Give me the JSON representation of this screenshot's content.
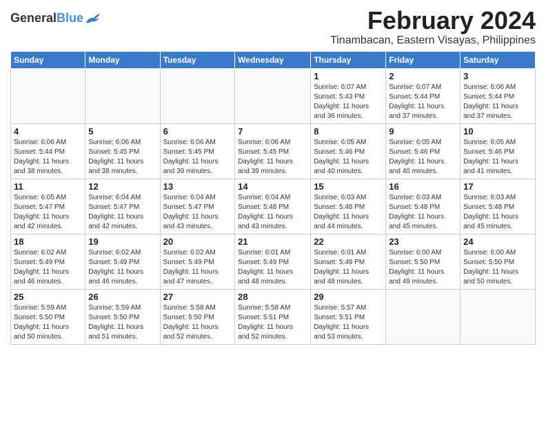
{
  "logo": {
    "text_general": "General",
    "text_blue": "Blue"
  },
  "title": {
    "month_year": "February 2024",
    "location": "Tinambacan, Eastern Visayas, Philippines"
  },
  "weekdays": [
    "Sunday",
    "Monday",
    "Tuesday",
    "Wednesday",
    "Thursday",
    "Friday",
    "Saturday"
  ],
  "weeks": [
    [
      {
        "day": "",
        "info": ""
      },
      {
        "day": "",
        "info": ""
      },
      {
        "day": "",
        "info": ""
      },
      {
        "day": "",
        "info": ""
      },
      {
        "day": "1",
        "info": "Sunrise: 6:07 AM\nSunset: 5:43 PM\nDaylight: 11 hours\nand 36 minutes."
      },
      {
        "day": "2",
        "info": "Sunrise: 6:07 AM\nSunset: 5:44 PM\nDaylight: 11 hours\nand 37 minutes."
      },
      {
        "day": "3",
        "info": "Sunrise: 6:06 AM\nSunset: 5:44 PM\nDaylight: 11 hours\nand 37 minutes."
      }
    ],
    [
      {
        "day": "4",
        "info": "Sunrise: 6:06 AM\nSunset: 5:44 PM\nDaylight: 11 hours\nand 38 minutes."
      },
      {
        "day": "5",
        "info": "Sunrise: 6:06 AM\nSunset: 5:45 PM\nDaylight: 11 hours\nand 38 minutes."
      },
      {
        "day": "6",
        "info": "Sunrise: 6:06 AM\nSunset: 5:45 PM\nDaylight: 11 hours\nand 39 minutes."
      },
      {
        "day": "7",
        "info": "Sunrise: 6:06 AM\nSunset: 5:45 PM\nDaylight: 11 hours\nand 39 minutes."
      },
      {
        "day": "8",
        "info": "Sunrise: 6:05 AM\nSunset: 5:46 PM\nDaylight: 11 hours\nand 40 minutes."
      },
      {
        "day": "9",
        "info": "Sunrise: 6:05 AM\nSunset: 5:46 PM\nDaylight: 11 hours\nand 40 minutes."
      },
      {
        "day": "10",
        "info": "Sunrise: 6:05 AM\nSunset: 5:46 PM\nDaylight: 11 hours\nand 41 minutes."
      }
    ],
    [
      {
        "day": "11",
        "info": "Sunrise: 6:05 AM\nSunset: 5:47 PM\nDaylight: 11 hours\nand 42 minutes."
      },
      {
        "day": "12",
        "info": "Sunrise: 6:04 AM\nSunset: 5:47 PM\nDaylight: 11 hours\nand 42 minutes."
      },
      {
        "day": "13",
        "info": "Sunrise: 6:04 AM\nSunset: 5:47 PM\nDaylight: 11 hours\nand 43 minutes."
      },
      {
        "day": "14",
        "info": "Sunrise: 6:04 AM\nSunset: 5:48 PM\nDaylight: 11 hours\nand 43 minutes."
      },
      {
        "day": "15",
        "info": "Sunrise: 6:03 AM\nSunset: 5:48 PM\nDaylight: 11 hours\nand 44 minutes."
      },
      {
        "day": "16",
        "info": "Sunrise: 6:03 AM\nSunset: 5:48 PM\nDaylight: 11 hours\nand 45 minutes."
      },
      {
        "day": "17",
        "info": "Sunrise: 6:03 AM\nSunset: 5:48 PM\nDaylight: 11 hours\nand 45 minutes."
      }
    ],
    [
      {
        "day": "18",
        "info": "Sunrise: 6:02 AM\nSunset: 5:49 PM\nDaylight: 11 hours\nand 46 minutes."
      },
      {
        "day": "19",
        "info": "Sunrise: 6:02 AM\nSunset: 5:49 PM\nDaylight: 11 hours\nand 46 minutes."
      },
      {
        "day": "20",
        "info": "Sunrise: 6:02 AM\nSunset: 5:49 PM\nDaylight: 11 hours\nand 47 minutes."
      },
      {
        "day": "21",
        "info": "Sunrise: 6:01 AM\nSunset: 5:49 PM\nDaylight: 11 hours\nand 48 minutes."
      },
      {
        "day": "22",
        "info": "Sunrise: 6:01 AM\nSunset: 5:49 PM\nDaylight: 11 hours\nand 48 minutes."
      },
      {
        "day": "23",
        "info": "Sunrise: 6:00 AM\nSunset: 5:50 PM\nDaylight: 11 hours\nand 49 minutes."
      },
      {
        "day": "24",
        "info": "Sunrise: 6:00 AM\nSunset: 5:50 PM\nDaylight: 11 hours\nand 50 minutes."
      }
    ],
    [
      {
        "day": "25",
        "info": "Sunrise: 5:59 AM\nSunset: 5:50 PM\nDaylight: 11 hours\nand 50 minutes."
      },
      {
        "day": "26",
        "info": "Sunrise: 5:59 AM\nSunset: 5:50 PM\nDaylight: 11 hours\nand 51 minutes."
      },
      {
        "day": "27",
        "info": "Sunrise: 5:58 AM\nSunset: 5:50 PM\nDaylight: 11 hours\nand 52 minutes."
      },
      {
        "day": "28",
        "info": "Sunrise: 5:58 AM\nSunset: 5:51 PM\nDaylight: 11 hours\nand 52 minutes."
      },
      {
        "day": "29",
        "info": "Sunrise: 5:57 AM\nSunset: 5:51 PM\nDaylight: 11 hours\nand 53 minutes."
      },
      {
        "day": "",
        "info": ""
      },
      {
        "day": "",
        "info": ""
      }
    ]
  ]
}
